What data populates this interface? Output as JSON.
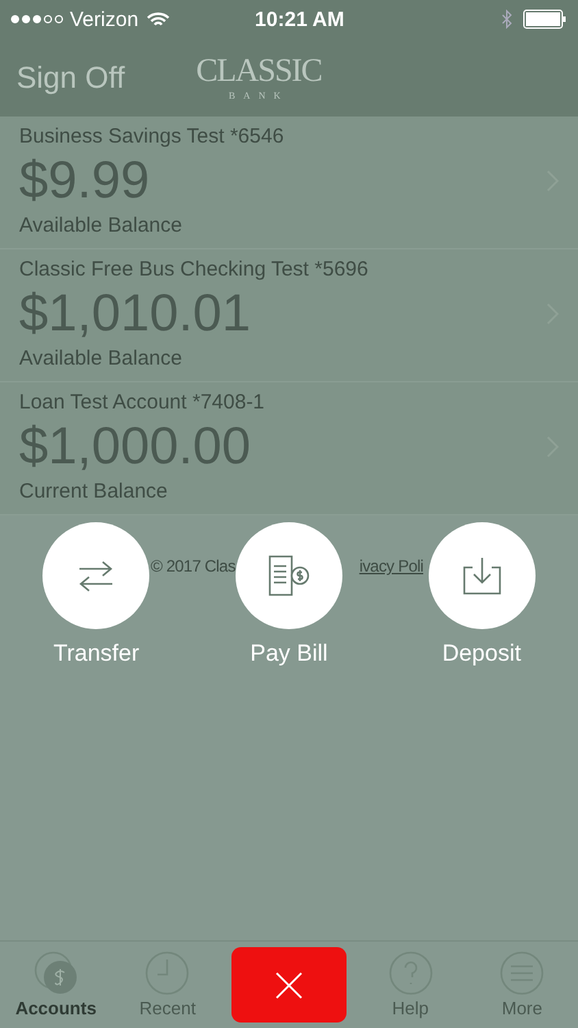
{
  "status_bar": {
    "carrier": "Verizon",
    "time": "10:21 AM"
  },
  "nav": {
    "left": "Sign Off",
    "logo": "CLASSIC",
    "logo_sub": "BANK"
  },
  "accounts": [
    {
      "name": "Business Savings Test *6546",
      "amount": "$9.99",
      "caption": "Available Balance"
    },
    {
      "name": "Classic Free Bus Checking Test *5696",
      "amount": "$1,010.01",
      "caption": "Available Balance"
    },
    {
      "name": "Loan Test Account *7408-1",
      "amount": "$1,000.00",
      "caption": "Current Balance"
    }
  ],
  "footer": {
    "copyright": "© 2017 Clas",
    "link": "ivacy Poli"
  },
  "actions": [
    {
      "kind": "transfer",
      "label": "Transfer"
    },
    {
      "kind": "bill",
      "label": "Pay Bill"
    },
    {
      "kind": "deposit",
      "label": "Deposit"
    }
  ],
  "tab_bar": [
    {
      "kind": "accounts",
      "label": "Accounts",
      "selected": true
    },
    {
      "kind": "recent",
      "label": "Recent",
      "selected": false
    },
    {
      "kind": "close"
    },
    {
      "kind": "help",
      "label": "Help",
      "selected": false
    },
    {
      "kind": "more",
      "label": "More",
      "selected": false
    }
  ]
}
